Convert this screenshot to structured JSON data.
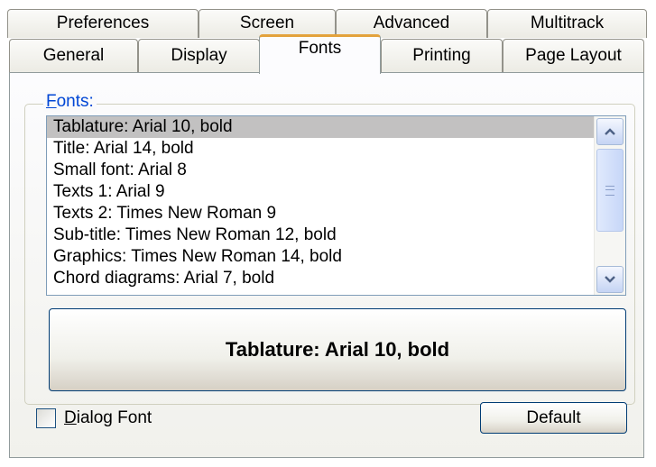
{
  "tabs": {
    "row1": [
      {
        "id": "preferences",
        "label": "Preferences"
      },
      {
        "id": "screen",
        "label": "Screen"
      },
      {
        "id": "advanced",
        "label": "Advanced"
      },
      {
        "id": "multitrack",
        "label": "Multitrack"
      }
    ],
    "row2": [
      {
        "id": "general",
        "label": "General"
      },
      {
        "id": "display",
        "label": "Display"
      },
      {
        "id": "fonts",
        "label": "Fonts",
        "active": true
      },
      {
        "id": "printing",
        "label": "Printing"
      },
      {
        "id": "page-layout",
        "label": "Page Layout"
      }
    ]
  },
  "fonts_group": {
    "label_mnemonic": "F",
    "label_rest": "onts:",
    "items": [
      "Tablature: Arial 10, bold",
      "Title: Arial 14, bold",
      "Small font: Arial 8",
      "Texts 1: Arial 9",
      "Texts 2: Times New Roman 9",
      "Sub-title: Times New Roman 12, bold",
      "Graphics: Times New Roman 14, bold",
      "Chord diagrams: Arial 7, bold"
    ],
    "selected_index": 0,
    "preview_label": "Tablature: Arial 10, bold"
  },
  "dialog_font": {
    "mnemonic": "D",
    "label_rest": "ialog Font",
    "checked": false
  },
  "default_button_label": "Default",
  "colors": {
    "active_tab_accent": "#e3a23c",
    "group_label": "#0046d5",
    "selection": "#c2c1c1"
  }
}
